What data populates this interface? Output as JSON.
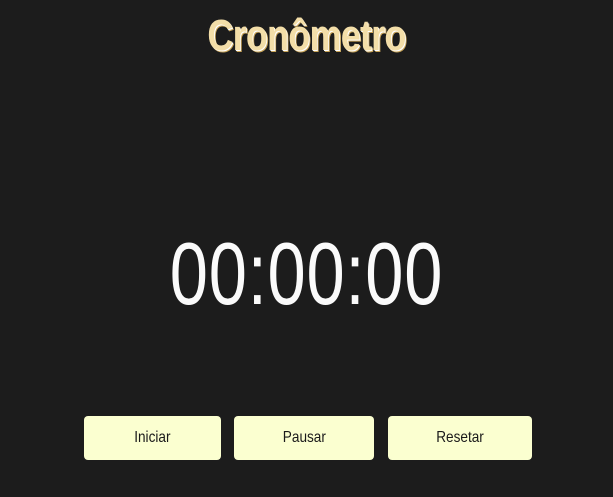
{
  "header": {
    "title": "Cronômetro"
  },
  "timer": {
    "display": "00:00:00"
  },
  "controls": {
    "start_label": "Iniciar",
    "pause_label": "Pausar",
    "reset_label": "Resetar"
  },
  "colors": {
    "background": "#1c1c1c",
    "title": "#f3dea8",
    "display": "#fafafa",
    "button_bg": "#fbffd0",
    "button_text": "#1a1a1a"
  }
}
